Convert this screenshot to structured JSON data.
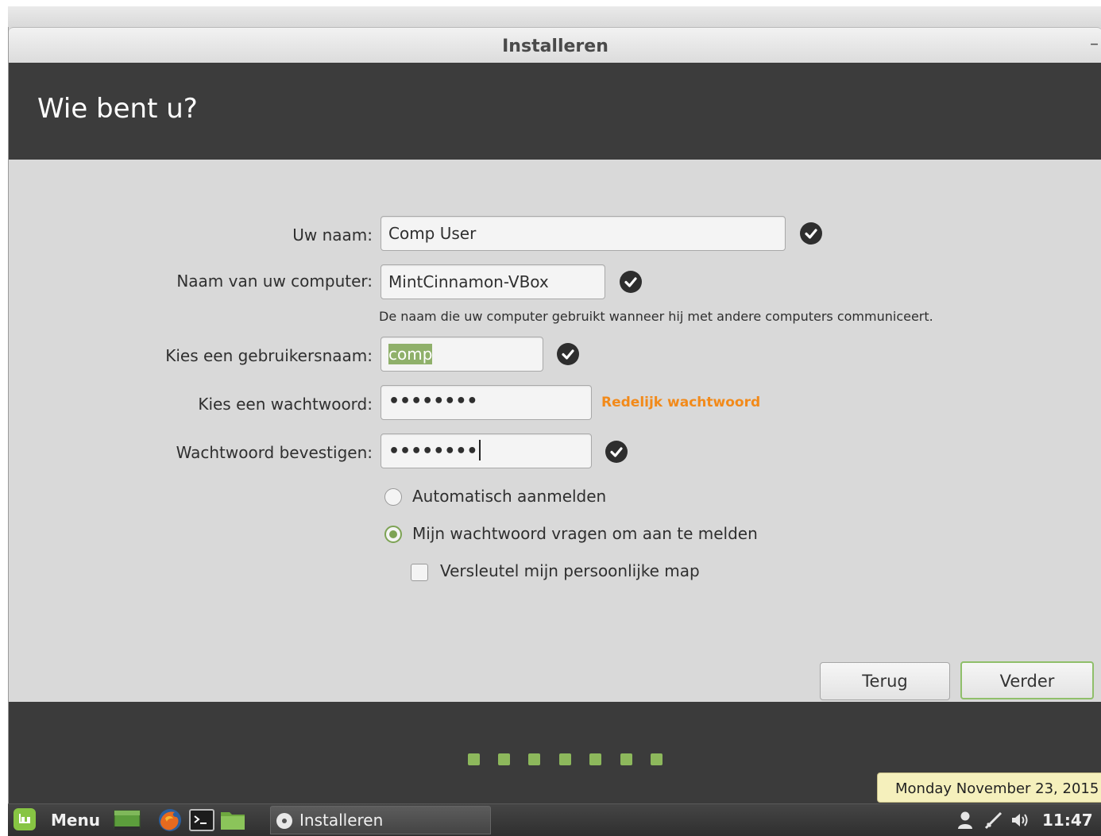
{
  "window": {
    "title": "Installeren",
    "minimize_glyph": "–"
  },
  "header": {
    "title": "Wie bent u?"
  },
  "form": {
    "name_label": "Uw naam:",
    "name_value": "Comp User",
    "computer_label": "Naam van uw computer:",
    "computer_value": "MintCinnamon-VBox",
    "computer_hint": "De naam die uw computer gebruikt wanneer hij met andere computers communiceert.",
    "username_label": "Kies een gebruikersnaam:",
    "username_value": "comp",
    "password_label": "Kies een wachtwoord:",
    "password_value": "••••••••",
    "password_strength": "Redelijk wachtwoord",
    "confirm_label": "Wachtwoord bevestigen:",
    "confirm_value": "••••••••",
    "auto_login_label": "Automatisch aanmelden",
    "ask_password_label": "Mijn wachtwoord vragen om aan te melden",
    "encrypt_label": "Versleutel mijn persoonlijke map",
    "login_mode_selected": "ask_password",
    "encrypt_checked": false
  },
  "buttons": {
    "back": "Terug",
    "next": "Verder"
  },
  "progress": {
    "steps": 7,
    "color": "#8db85c"
  },
  "taskbar": {
    "menu_label": "Menu",
    "task_label": "Installeren",
    "clock": "11:47",
    "tooltip": "Monday November 23, 2015"
  },
  "colors": {
    "accent": "#8fb06a",
    "warning": "#f28a1a",
    "header_bg": "#3c3c3c"
  },
  "icons": [
    "checkmark-icon",
    "mint-menu-icon",
    "show-desktop-icon",
    "firefox-icon",
    "terminal-icon",
    "files-icon",
    "installer-icon",
    "user-icon",
    "network-icon",
    "volume-icon"
  ]
}
